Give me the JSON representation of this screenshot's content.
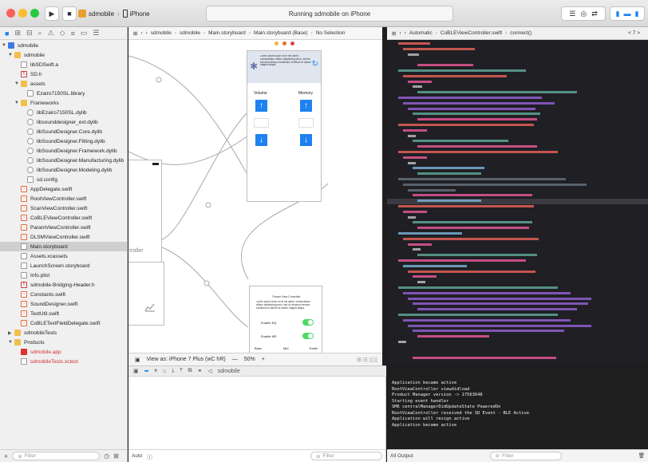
{
  "toolbar": {
    "scheme_target": "sdmobile",
    "scheme_device": "iPhone",
    "status_text": "Running sdmobile on iPhone"
  },
  "navigator": {
    "items": [
      {
        "label": "sdmobile",
        "indent": 0,
        "icon": "project",
        "caret": "▼"
      },
      {
        "label": "sdmobile",
        "indent": 1,
        "icon": "folder",
        "caret": "▼"
      },
      {
        "label": "libSDSwift.a",
        "indent": 2,
        "icon": "file",
        "caret": ""
      },
      {
        "label": "SD.h",
        "indent": 2,
        "icon": "h",
        "caret": ""
      },
      {
        "label": "assets",
        "indent": 2,
        "icon": "folder",
        "caret": "▼"
      },
      {
        "label": "Ezairo7150SL.library",
        "indent": 3,
        "icon": "file",
        "caret": ""
      },
      {
        "label": "Frameworks",
        "indent": 2,
        "icon": "folder",
        "caret": "▼"
      },
      {
        "label": "libEzairo7150SL.dylib",
        "indent": 3,
        "icon": "lib",
        "caret": ""
      },
      {
        "label": "libsounddesigner_ext.dylib",
        "indent": 3,
        "icon": "lib",
        "caret": ""
      },
      {
        "label": "libSoundDesigner.Core.dylib",
        "indent": 3,
        "icon": "lib",
        "caret": ""
      },
      {
        "label": "libSoundDesigner.Fitting.dylib",
        "indent": 3,
        "icon": "lib",
        "caret": ""
      },
      {
        "label": "libSoundDesigner.Framework.dylib",
        "indent": 3,
        "icon": "lib",
        "caret": ""
      },
      {
        "label": "libSoundDesigner.Manufacturing.dylib",
        "indent": 3,
        "icon": "lib",
        "caret": ""
      },
      {
        "label": "libSoundDesigner.Modeling.dylib",
        "indent": 3,
        "icon": "lib",
        "caret": ""
      },
      {
        "label": "sd.config",
        "indent": 3,
        "icon": "file",
        "caret": ""
      },
      {
        "label": "AppDelegate.swift",
        "indent": 2,
        "icon": "swift",
        "caret": ""
      },
      {
        "label": "RootViewController.swift",
        "indent": 2,
        "icon": "swift",
        "caret": ""
      },
      {
        "label": "ScanViewController.swift",
        "indent": 2,
        "icon": "swift",
        "caret": ""
      },
      {
        "label": "CoBLEViewController.swift",
        "indent": 2,
        "icon": "swift",
        "caret": ""
      },
      {
        "label": "ParamViewController.swift",
        "indent": 2,
        "icon": "swift",
        "caret": ""
      },
      {
        "label": "DLSMViewController.swift",
        "indent": 2,
        "icon": "swift",
        "caret": ""
      },
      {
        "label": "Main.storyboard",
        "indent": 2,
        "icon": "file",
        "caret": "",
        "selected": true
      },
      {
        "label": "Assets.xcassets",
        "indent": 2,
        "icon": "file",
        "caret": ""
      },
      {
        "label": "LaunchScreen.storyboard",
        "indent": 2,
        "icon": "file",
        "caret": ""
      },
      {
        "label": "Info.plist",
        "indent": 2,
        "icon": "file",
        "caret": ""
      },
      {
        "label": "sdmobile-Bridging-Header.h",
        "indent": 2,
        "icon": "h",
        "caret": ""
      },
      {
        "label": "Constants.swift",
        "indent": 2,
        "icon": "swift",
        "caret": ""
      },
      {
        "label": "SoundDesigner.swift",
        "indent": 2,
        "icon": "swift",
        "caret": ""
      },
      {
        "label": "TextUtil.swift",
        "indent": 2,
        "icon": "swift",
        "caret": ""
      },
      {
        "label": "CoBLETextFieldDelegate.swift",
        "indent": 2,
        "icon": "swift",
        "caret": ""
      },
      {
        "label": "sdmobileTests",
        "indent": 1,
        "icon": "folder",
        "caret": "▶"
      },
      {
        "label": "Products",
        "indent": 1,
        "icon": "folder",
        "caret": "▼"
      },
      {
        "label": "sdmobile.app",
        "indent": 2,
        "icon": "app",
        "caret": "",
        "red": true
      },
      {
        "label": "sdmobileTests.xctest",
        "indent": 2,
        "icon": "file",
        "caret": "",
        "red": true
      }
    ],
    "filter_placeholder": "Filter"
  },
  "storyboard": {
    "breadcrumb": [
      "sdmobile",
      "sdmobile",
      "Main.storyboard",
      "Main.storyboard (Base)",
      "No Selection"
    ],
    "volume_label": "Volume",
    "memory_label": "Memory",
    "scene_lorem": "Lorem ipsum dolor sit er elit lamet, consectetaur cillium adipisicing pecu, sed do eiusmod tempor incididunt ut labore et dolore magna aliqua.",
    "controller_label": "troller",
    "param_title": "Param View Controller",
    "enable_eq": "Enable EQ",
    "enable_nr": "Enable NR",
    "bass": "Bass",
    "mid": "Mid",
    "treble": "Treble",
    "view_as": "View as: iPhone 7 Plus (wC hR)",
    "zoom": "50%"
  },
  "editor": {
    "breadcrumb": [
      "Automatic",
      "CoBLEViewController.swift",
      "connect()"
    ],
    "counter": "< 7 >"
  },
  "debug": {
    "scheme_label": "sdmobile",
    "auto_label": "Auto",
    "filter_placeholder": "Filter",
    "output_label": "All Output"
  },
  "console": {
    "lines": [
      "Application became active",
      "RootViewController viewdidload",
      "Product Manager version -> 17563648",
      "Starting event handler",
      "SM6 centralManagerDidUpdateState PoweredOn",
      "RootViewController received the SD Event - BLE Active",
      "Application will resign active",
      "Application became active"
    ]
  },
  "colors": {
    "keyword": "#fc5fa3",
    "string": "#fc6a5d",
    "type": "#a167e6",
    "comment": "#6c7986",
    "accent_blue": "#1e82f0",
    "toggle_green": "#4cd964"
  }
}
